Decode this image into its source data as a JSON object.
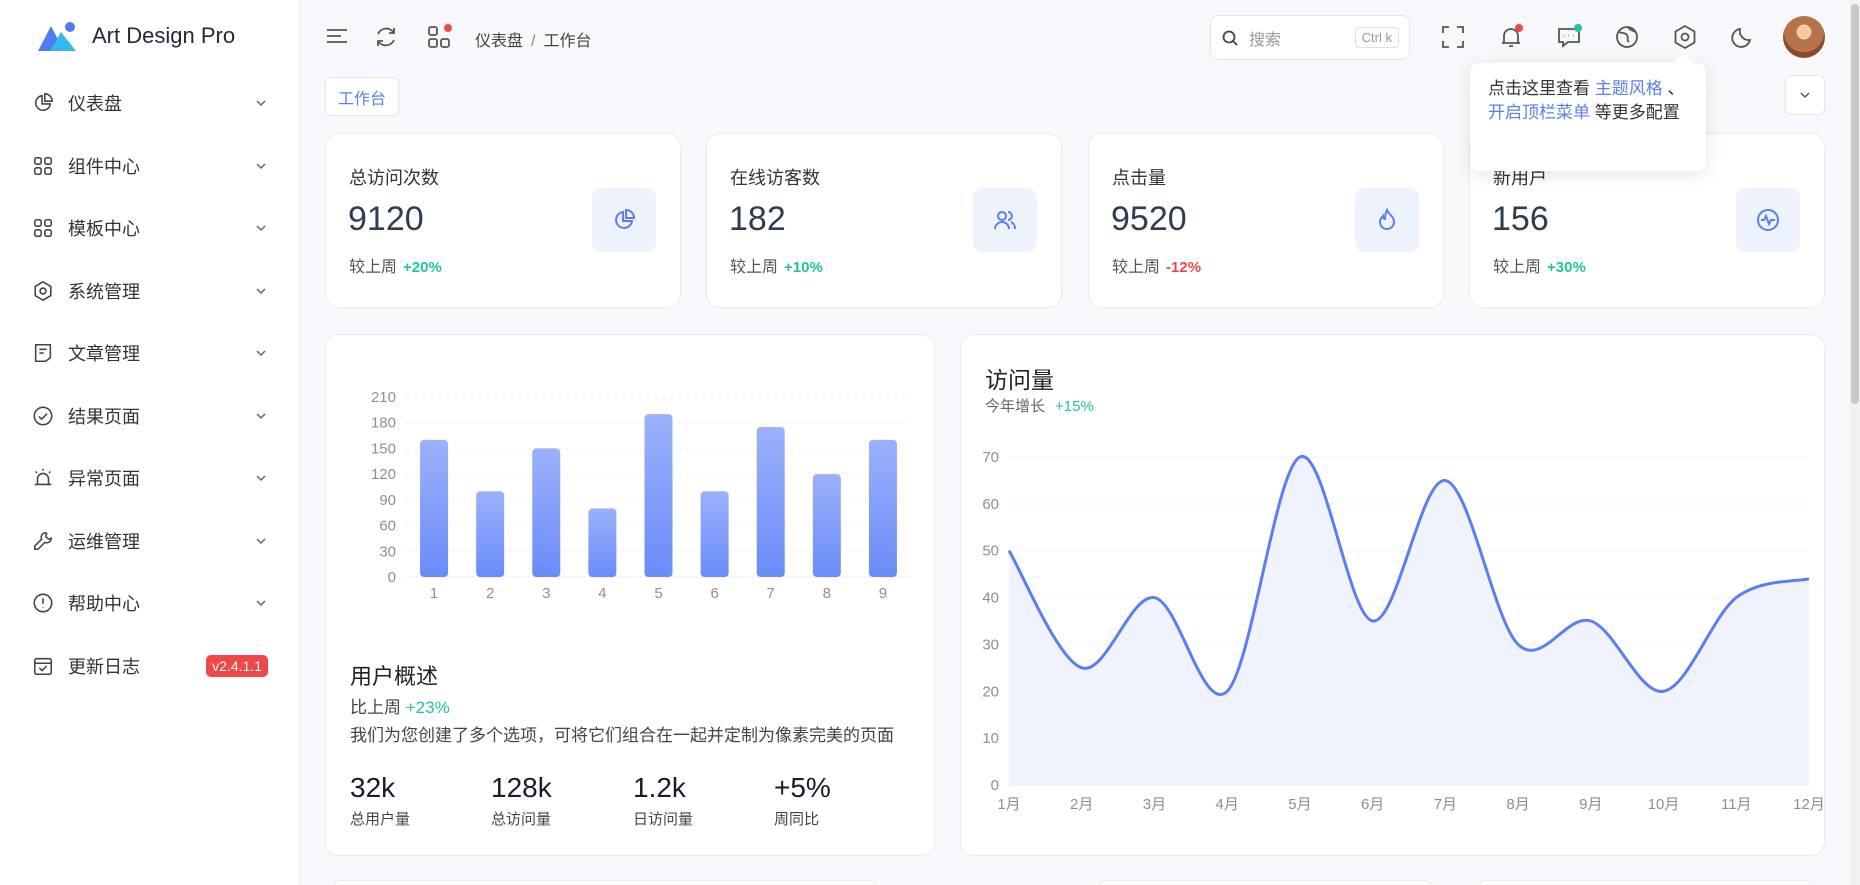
{
  "app": {
    "name": "Art Design Pro"
  },
  "sidebar": {
    "items": [
      {
        "label": "仪表盘",
        "icon": "pie-chart-icon"
      },
      {
        "label": "组件中心",
        "icon": "grid-icon"
      },
      {
        "label": "模板中心",
        "icon": "grid-icon"
      },
      {
        "label": "系统管理",
        "icon": "gear-icon"
      },
      {
        "label": "文章管理",
        "icon": "article-icon"
      },
      {
        "label": "结果页面",
        "icon": "check-circle-icon"
      },
      {
        "label": "异常页面",
        "icon": "alarm-icon"
      },
      {
        "label": "运维管理",
        "icon": "wrench-icon"
      },
      {
        "label": "帮助中心",
        "icon": "exclamation-circle-icon"
      },
      {
        "label": "更新日志",
        "icon": "calendar-check-icon",
        "badge": "v2.4.1.1"
      }
    ]
  },
  "header": {
    "breadcrumb": [
      "仪表盘",
      "工作台"
    ],
    "search_placeholder": "搜索",
    "search_shortcut": "Ctrl k",
    "colors": {
      "notify_dot": "#f04848",
      "message_dot": "#22c3a1",
      "menu_dot": "#f04848"
    }
  },
  "tabs": [
    {
      "label": "工作台"
    }
  ],
  "tooltip": {
    "prefix": "点击这里查看",
    "link1": "主题风格",
    "mid": "、",
    "link2": "开启顶栏菜单",
    "suffix": "等更多配置"
  },
  "stats": [
    {
      "title": "总访问次数",
      "value": "9120",
      "compare_label": "较上周",
      "change": "+20%",
      "trend": "up",
      "icon": "pie-chart-icon"
    },
    {
      "title": "在线访客数",
      "value": "182",
      "compare_label": "较上周",
      "change": "+10%",
      "trend": "up",
      "icon": "users-icon"
    },
    {
      "title": "点击量",
      "value": "9520",
      "compare_label": "较上周",
      "change": "-12%",
      "trend": "down",
      "icon": "fire-icon"
    },
    {
      "title": "新用户",
      "value": "156",
      "compare_label": "较上周",
      "change": "+30%",
      "trend": "up",
      "icon": "pulse-icon"
    }
  ],
  "overview": {
    "title": "用户概述",
    "compare_label": "比上周",
    "change": "+23%",
    "description": "我们为您创建了多个选项，可将它们组合在一起并定制为像素完美的页面",
    "stats": [
      {
        "value": "32k",
        "label": "总用户量"
      },
      {
        "value": "128k",
        "label": "总访问量"
      },
      {
        "value": "1.2k",
        "label": "日访问量"
      },
      {
        "value": "+5%",
        "label": "周同比"
      }
    ]
  },
  "visits": {
    "title": "访问量",
    "subtitle": "今年增长",
    "change": "+15%"
  },
  "chart_data": [
    {
      "type": "bar",
      "categories": [
        "1",
        "2",
        "3",
        "4",
        "5",
        "6",
        "7",
        "8",
        "9"
      ],
      "values": [
        160,
        100,
        150,
        80,
        190,
        100,
        175,
        120,
        160
      ],
      "yticks": [
        0,
        30,
        60,
        90,
        120,
        150,
        180,
        210
      ],
      "ylim": [
        0,
        210
      ],
      "grid": true,
      "colors": {
        "top": "#9cb1fb",
        "bottom": "#6a8cf8"
      }
    },
    {
      "type": "area",
      "categories": [
        "1月",
        "2月",
        "3月",
        "4月",
        "5月",
        "6月",
        "7月",
        "8月",
        "9月",
        "10月",
        "11月",
        "12月"
      ],
      "values": [
        50,
        25,
        40,
        20,
        70,
        35,
        65,
        30,
        35,
        20,
        40,
        44
      ],
      "yticks": [
        0,
        10,
        20,
        30,
        40,
        50,
        60,
        70
      ],
      "ylim": [
        0,
        70
      ],
      "grid": true,
      "colors": {
        "line": "#5b7ff0",
        "fill": "#eef2fd"
      }
    }
  ]
}
